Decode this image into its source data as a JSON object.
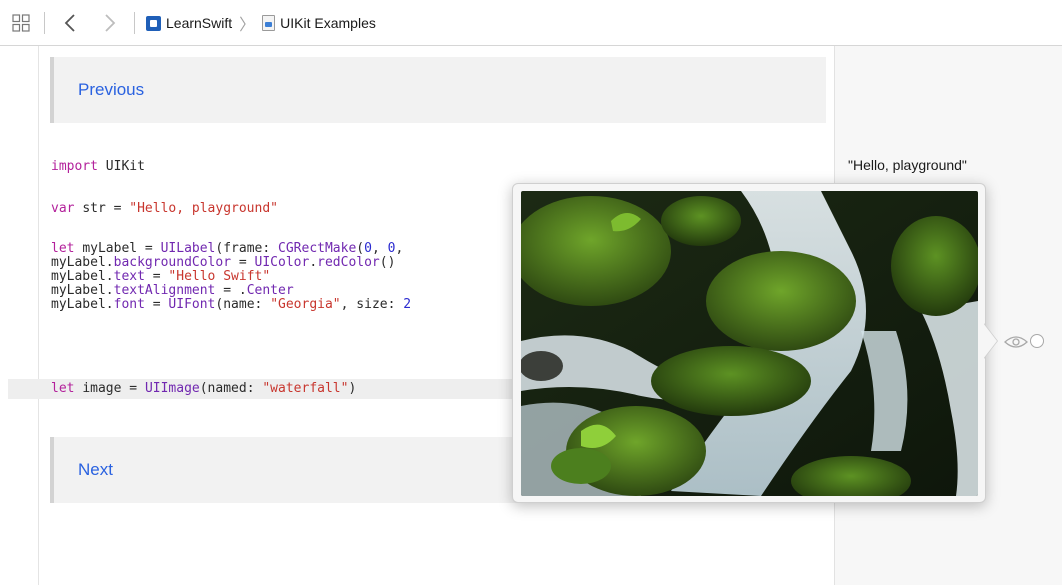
{
  "toolbar": {
    "icons": {
      "grid": "grid-icon",
      "back": "chevron-left-icon",
      "forward": "chevron-right-icon"
    },
    "breadcrumb": {
      "project": "LearnSwift",
      "file": "UIKit Examples",
      "separator": "〉"
    }
  },
  "editor": {
    "previous_link": "Previous",
    "next_link": "Next",
    "code": {
      "import_kw": "import",
      "import_mod": "UIKit",
      "var_kw": "var",
      "var_rest": "str = ",
      "var_str": "\"Hello, playground\"",
      "l1_kw": "let",
      "l1_rest": "myLabel = ",
      "l1_type": "UILabel",
      "l1_mid": "(frame: ",
      "l1_fn": "CGRectMake",
      "l1_args": "(",
      "l1_n1": "0",
      "l1_c1": ", ",
      "l1_n2": "0",
      "l1_c2": ",",
      "l2_a": "myLabel.",
      "l2_prop": "backgroundColor",
      "l2_b": " = ",
      "l2_type": "UIColor",
      "l2_c": ".",
      "l2_fn": "redColor",
      "l2_d": "()",
      "l3_a": "myLabel.",
      "l3_prop": "text",
      "l3_b": " = ",
      "l3_str": "\"Hello Swift\"",
      "l4_a": "myLabel.",
      "l4_prop": "textAlignment",
      "l4_b": " = .",
      "l4_c": "Center",
      "l5_a": "myLabel.",
      "l5_prop": "font",
      "l5_b": " = ",
      "l5_type": "UIFont",
      "l5_c": "(name: ",
      "l5_str": "\"Georgia\"",
      "l5_d": ", size: ",
      "l5_num": "2",
      "img_kw": "let",
      "img_rest": "image = ",
      "img_type": "UIImage",
      "img_mid": "(named: ",
      "img_str": "\"waterfall\"",
      "img_end": ")"
    }
  },
  "results": {
    "str_result": "\"Hello, playground\""
  },
  "quicklook": {
    "image_subject": "waterfall",
    "icons": {
      "eye": "eye-icon",
      "result": "circle-icon"
    }
  },
  "colors": {
    "keyword": "#b3219b",
    "string": "#c8362e",
    "type": "#7128b0",
    "link": "#2a62e0"
  }
}
